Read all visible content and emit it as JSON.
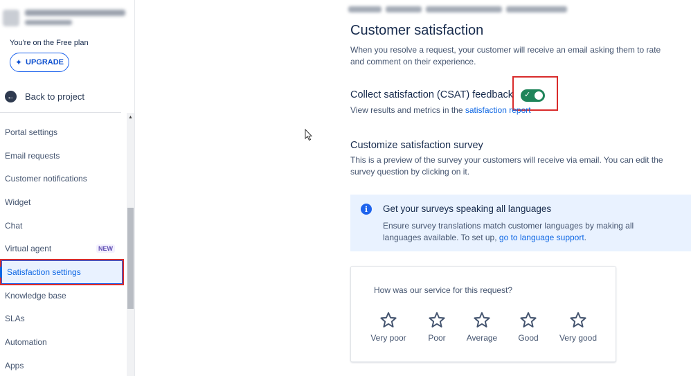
{
  "sidebar": {
    "plan_text": "You're on the Free plan",
    "upgrade_label": "UPGRADE",
    "back_label": "Back to project",
    "items": [
      {
        "label": "Portal settings"
      },
      {
        "label": "Email requests"
      },
      {
        "label": "Customer notifications"
      },
      {
        "label": "Widget"
      },
      {
        "label": "Chat"
      },
      {
        "label": "Virtual agent",
        "badge": "NEW"
      },
      {
        "label": "Satisfaction settings",
        "active": true
      },
      {
        "label": "Knowledge base"
      },
      {
        "label": "SLAs"
      },
      {
        "label": "Automation"
      },
      {
        "label": "Apps"
      }
    ]
  },
  "main": {
    "title": "Customer satisfaction",
    "intro": "When you resolve a request, your customer will receive an email asking them to rate and comment on their experience.",
    "csat": {
      "title": "Collect satisfaction (CSAT) feedback",
      "enabled": true,
      "sub_prefix": "View results and metrics in the ",
      "sub_link": "satisfaction report"
    },
    "survey": {
      "title": "Customize satisfaction survey",
      "description": "This is a preview of the survey your customers will receive via email. You can edit the survey question by clicking on it."
    },
    "info": {
      "title": "Get your surveys speaking all languages",
      "desc_prefix": "Ensure survey translations match customer languages by making all languages available. To set up, ",
      "link": "go to language support",
      "desc_suffix": "."
    },
    "card": {
      "question": "How was our service for this request?",
      "ratings": [
        "Very poor",
        "Poor",
        "Average",
        "Good",
        "Very good"
      ]
    }
  },
  "colors": {
    "accent": "#0c66e4",
    "toggle_on": "#1f845a",
    "highlight_box": "#d92b2b",
    "info_bg": "#e9f2ff"
  }
}
